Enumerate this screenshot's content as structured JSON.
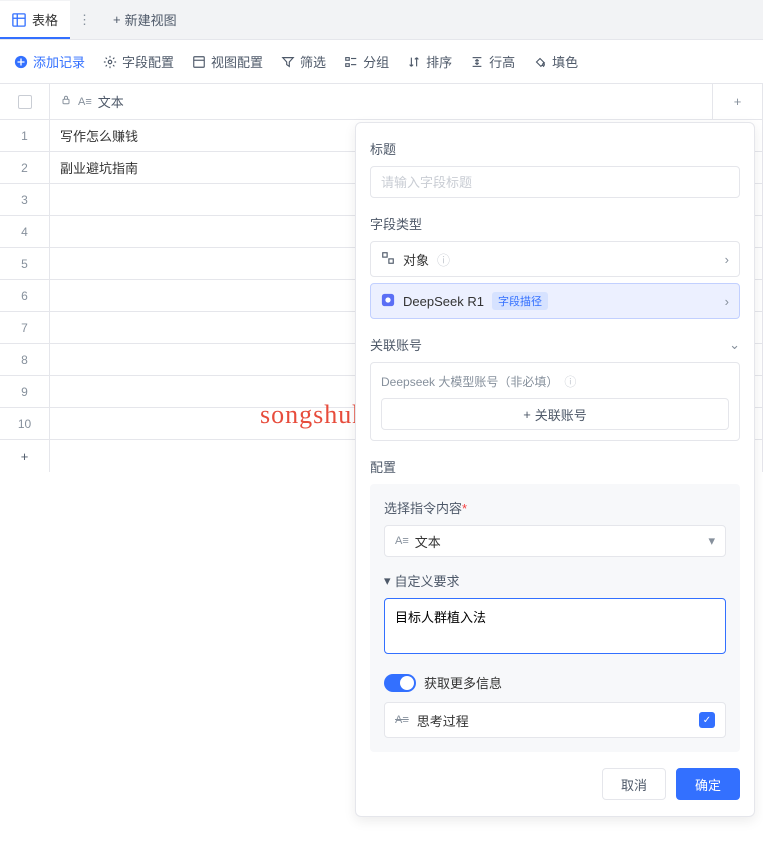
{
  "tabs": {
    "active": "表格",
    "new_view": "新建视图"
  },
  "toolbar": {
    "add_record": "添加记录",
    "field_config": "字段配置",
    "view_config": "视图配置",
    "filter": "筛选",
    "group": "分组",
    "sort": "排序",
    "row_height": "行高",
    "fill": "填色"
  },
  "table": {
    "column_header": "文本",
    "rows": [
      {
        "num": "1",
        "text": "写作怎么赚钱"
      },
      {
        "num": "2",
        "text": "副业避坑指南"
      },
      {
        "num": "3",
        "text": ""
      },
      {
        "num": "4",
        "text": ""
      },
      {
        "num": "5",
        "text": ""
      },
      {
        "num": "6",
        "text": ""
      },
      {
        "num": "7",
        "text": ""
      },
      {
        "num": "8",
        "text": ""
      },
      {
        "num": "9",
        "text": ""
      },
      {
        "num": "10",
        "text": ""
      }
    ]
  },
  "watermark": "songshuhezi.com",
  "panel": {
    "title_label": "标题",
    "title_placeholder": "请输入字段标题",
    "type_label": "字段类型",
    "type_options": {
      "object": "对象",
      "deepseek": "DeepSeek R1",
      "deepseek_badge": "字段描径"
    },
    "account_label": "关联账号",
    "account_desc": "Deepseek 大模型账号（非必填）",
    "account_btn": "关联账号",
    "config_label": "配置",
    "instruction_label": "选择指令内容",
    "instruction_value": "文本",
    "custom_label": "自定义要求",
    "custom_value": "目标人群植入法",
    "more_info": "获取更多信息",
    "think_process": "思考过程",
    "cancel": "取消",
    "confirm": "确定"
  }
}
